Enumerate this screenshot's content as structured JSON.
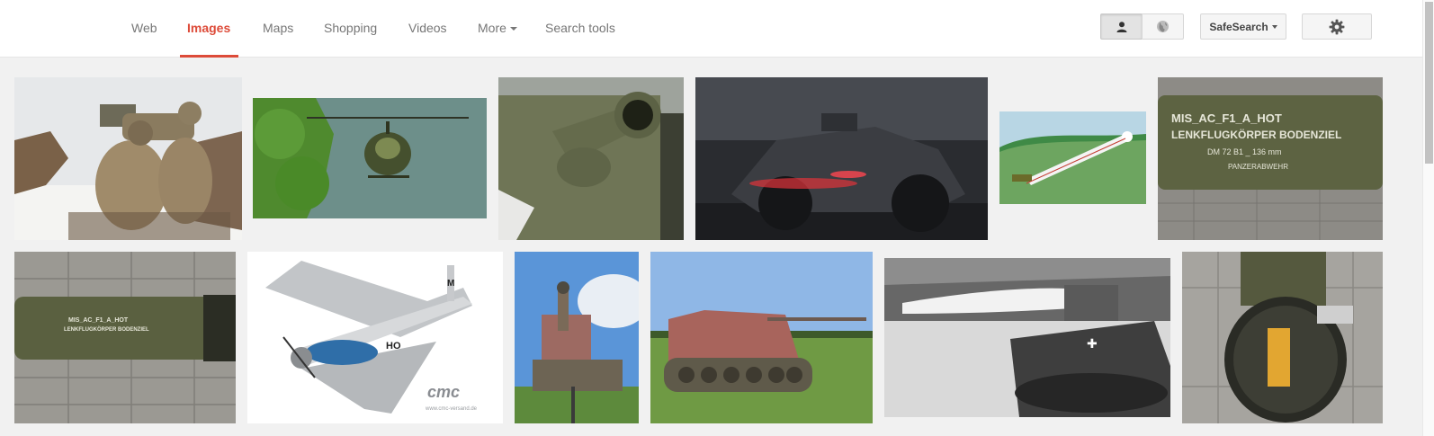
{
  "nav": {
    "tabs": [
      {
        "label": "Web"
      },
      {
        "label": "Images",
        "active": true
      },
      {
        "label": "Maps"
      },
      {
        "label": "Shopping"
      },
      {
        "label": "Videos"
      },
      {
        "label": "More",
        "has_dropdown": true
      },
      {
        "label": "Search tools"
      }
    ]
  },
  "toolbar": {
    "safesearch_label": "SafeSearch",
    "view_toggle": {
      "selected": "person-icon",
      "other": "globe-icon"
    },
    "settings_icon": "gear-icon"
  },
  "results": {
    "images": [
      {
        "subject": "soldiers-with-missile-launcher"
      },
      {
        "subject": "helicopter-over-water"
      },
      {
        "subject": "tank-gun-barrel"
      },
      {
        "subject": "batmobile-in-rain"
      },
      {
        "subject": "missile-diagram"
      },
      {
        "subject": "missile-tube-label",
        "text_lines": [
          "MIS_AC_F1_A_HOT",
          "LENKFLUGKÖRPER BODENZIEL",
          "DM 72 B1 _ 136 mm",
          "PANZERABWEHR"
        ]
      },
      {
        "subject": "missile-tube-on-pavement",
        "text_lines": [
          "MIS_AC_F1_A_HOT",
          "LENKFLUGKÖRPER BODENZIEL"
        ]
      },
      {
        "subject": "p51-model-airplane",
        "text_lines": [
          "HO",
          "M",
          "cmc",
          "www.cmc-versand.de"
        ]
      },
      {
        "subject": "tank-destroyer-front"
      },
      {
        "subject": "tank-destroyer-side"
      },
      {
        "subject": "tank-firing-missile-bw"
      },
      {
        "subject": "missile-tube-end"
      }
    ]
  },
  "colors": {
    "accent": "#dd4b39",
    "page_bg": "#f1f1f1"
  }
}
